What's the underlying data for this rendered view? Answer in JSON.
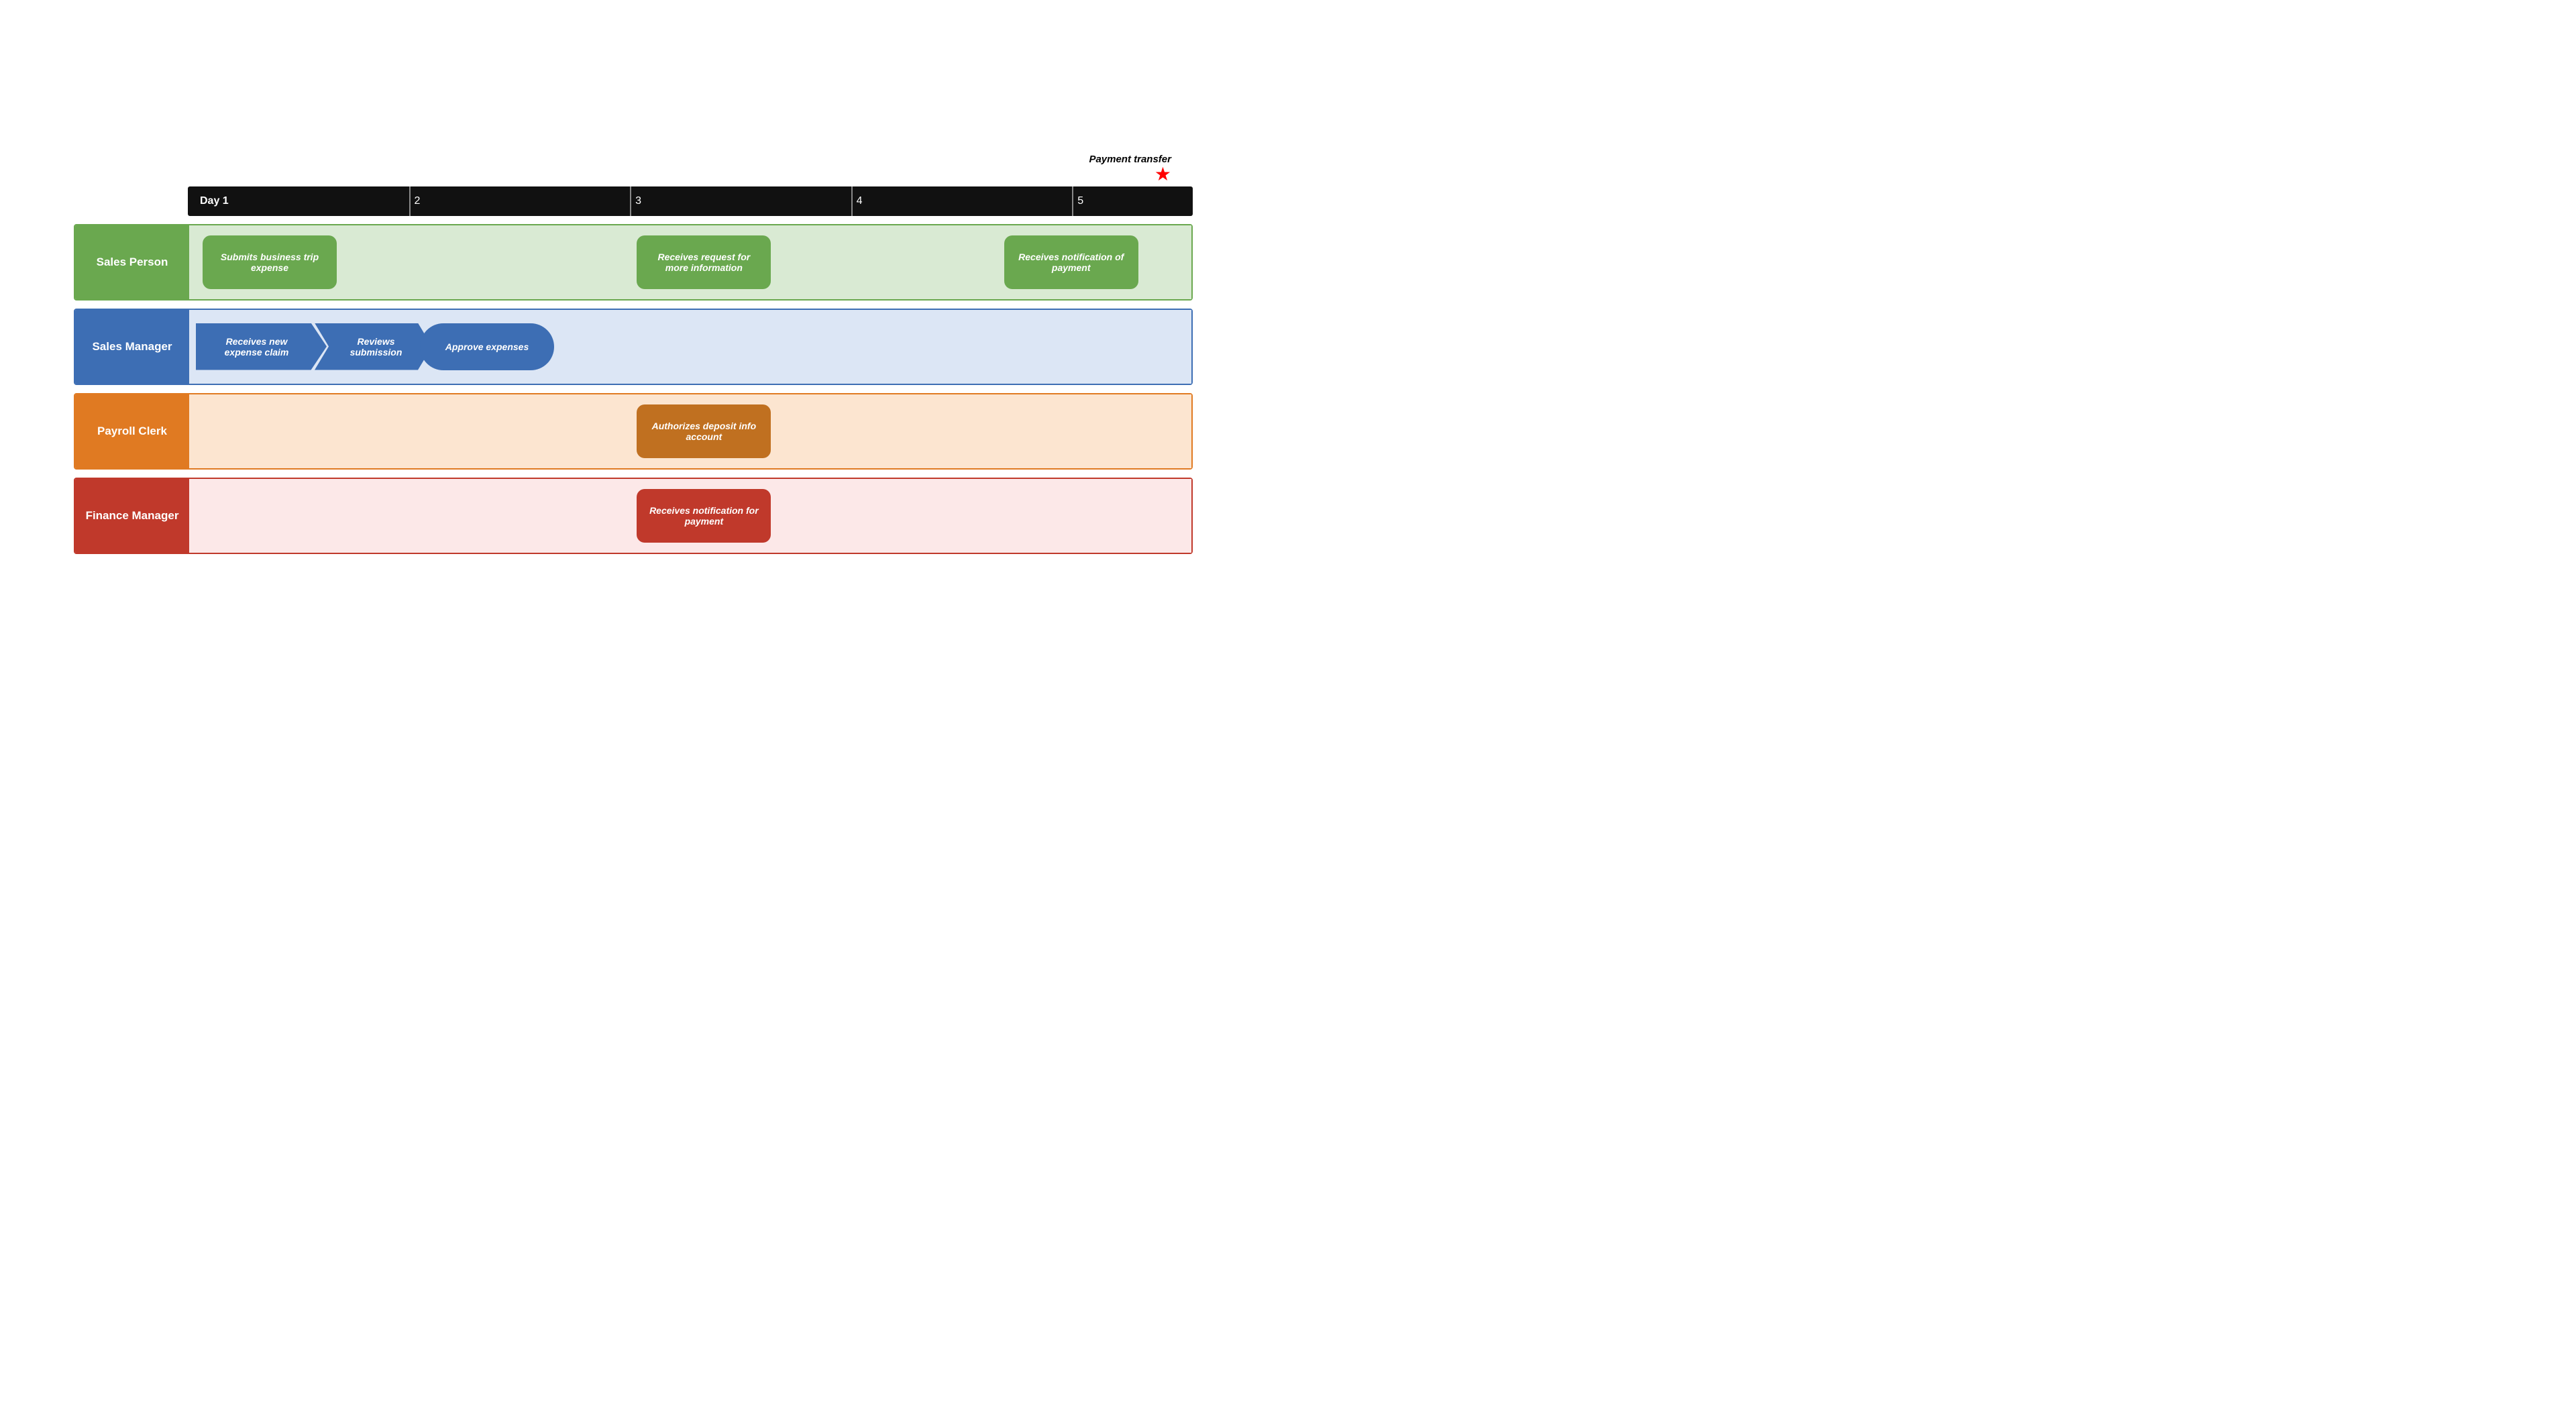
{
  "timeline": {
    "day1_label": "Day 1",
    "ticks": [
      "2",
      "3",
      "4",
      "5"
    ]
  },
  "payment_transfer": {
    "label": "Payment transfer"
  },
  "lanes": {
    "sales_person": {
      "label": "Sales Person",
      "activities": [
        {
          "text": "Submits business trip expense",
          "col": 1
        },
        {
          "text": "Receives request for more information",
          "col": 3
        },
        {
          "text": "Receives notification of payment",
          "col": 5
        }
      ]
    },
    "sales_manager": {
      "label": "Sales Manager",
      "activities": [
        {
          "text": "Receives new expense claim",
          "col": 1
        },
        {
          "text": "Reviews submission",
          "col": 2
        },
        {
          "text": "Approve expenses",
          "col": 3
        }
      ]
    },
    "payroll_clerk": {
      "label": "Payroll Clerk",
      "activities": [
        {
          "text": "Authorizes deposit info account",
          "col": 3
        }
      ]
    },
    "finance_manager": {
      "label": "Finance Manager",
      "activities": [
        {
          "text": "Receives notification for payment",
          "col": 3
        }
      ]
    }
  }
}
